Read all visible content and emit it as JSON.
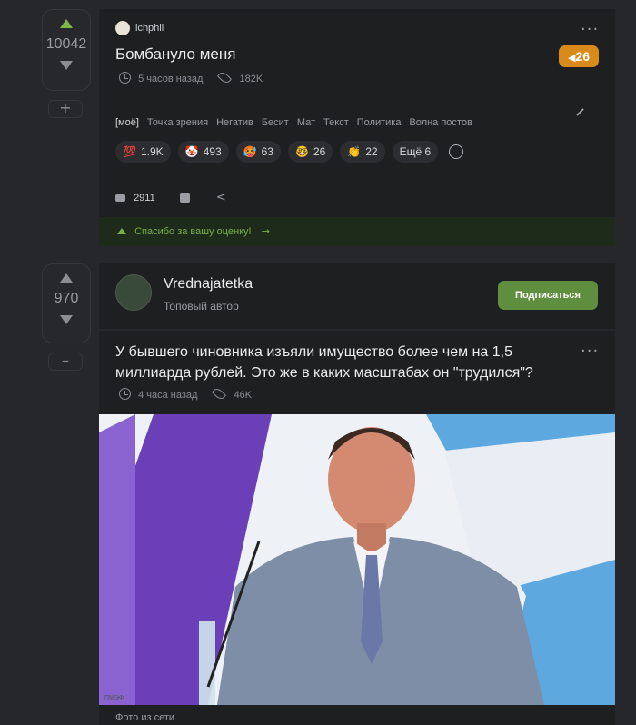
{
  "post1": {
    "rating": "10042",
    "author": "ichphil",
    "title": "Бомбануло меня",
    "badge": "26",
    "time": "5 часов назад",
    "views": "182K",
    "tags": [
      "[моё]",
      "Точка зрения",
      "Негатив",
      "Бесит",
      "Мат",
      "Текст",
      "Политика",
      "Волна постов"
    ],
    "reactions": [
      {
        "emoji": "💯",
        "count": "1.9K"
      },
      {
        "emoji": "🤡",
        "count": "493"
      },
      {
        "emoji": "🥵",
        "count": "63"
      },
      {
        "emoji": "🤓",
        "count": "26"
      },
      {
        "emoji": "👏",
        "count": "22"
      }
    ],
    "more_reactions": "Ещё 6",
    "comments": "2911",
    "thanks": "Спасибо за вашу оценку!"
  },
  "post2": {
    "rating": "970",
    "author": "Vrednajatetka",
    "author_status": "Топовый автор",
    "subscribe": "Подписаться",
    "title": "У бывшего чиновника изъяли имущество более чем на 1,5 миллиарда рублей. Это же в каких масштабах он \"трудился\"?",
    "time": "4 часа назад",
    "views": "46K",
    "caption": "Фото из сети"
  },
  "colors": {
    "accent_green": "#6a9e3c",
    "badge_orange": "#d98a1b",
    "background": "#25272a",
    "card": "#1d1f21"
  }
}
